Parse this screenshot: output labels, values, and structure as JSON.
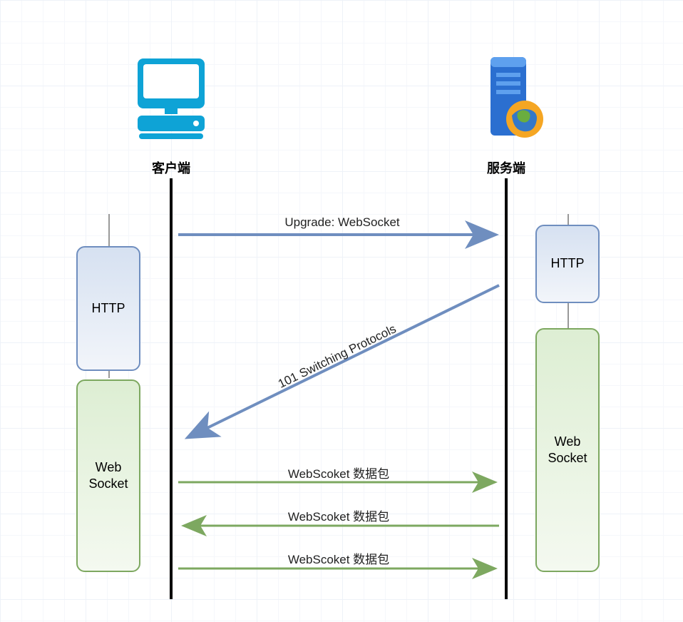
{
  "endpoints": {
    "client": {
      "label": "客户端"
    },
    "server": {
      "label": "服务端"
    }
  },
  "boxes": {
    "client_http": {
      "label": "HTTP"
    },
    "client_ws": {
      "label": "Web\nSocket"
    },
    "server_http": {
      "label": "HTTP"
    },
    "server_ws": {
      "label": "Web\nSocket"
    }
  },
  "messages": {
    "upgrade": {
      "label": "Upgrade: WebSocket"
    },
    "switching": {
      "label": "101 Switching Protocols"
    },
    "data1": {
      "label": "WebScoket 数据包"
    },
    "data2": {
      "label": "WebScoket 数据包"
    },
    "data3": {
      "label": "WebScoket 数据包"
    }
  },
  "colors": {
    "blue_arrow": "#6f8ebf",
    "green_arrow": "#7da860",
    "http_border": "#6f8ebf",
    "ws_border": "#7da860"
  }
}
